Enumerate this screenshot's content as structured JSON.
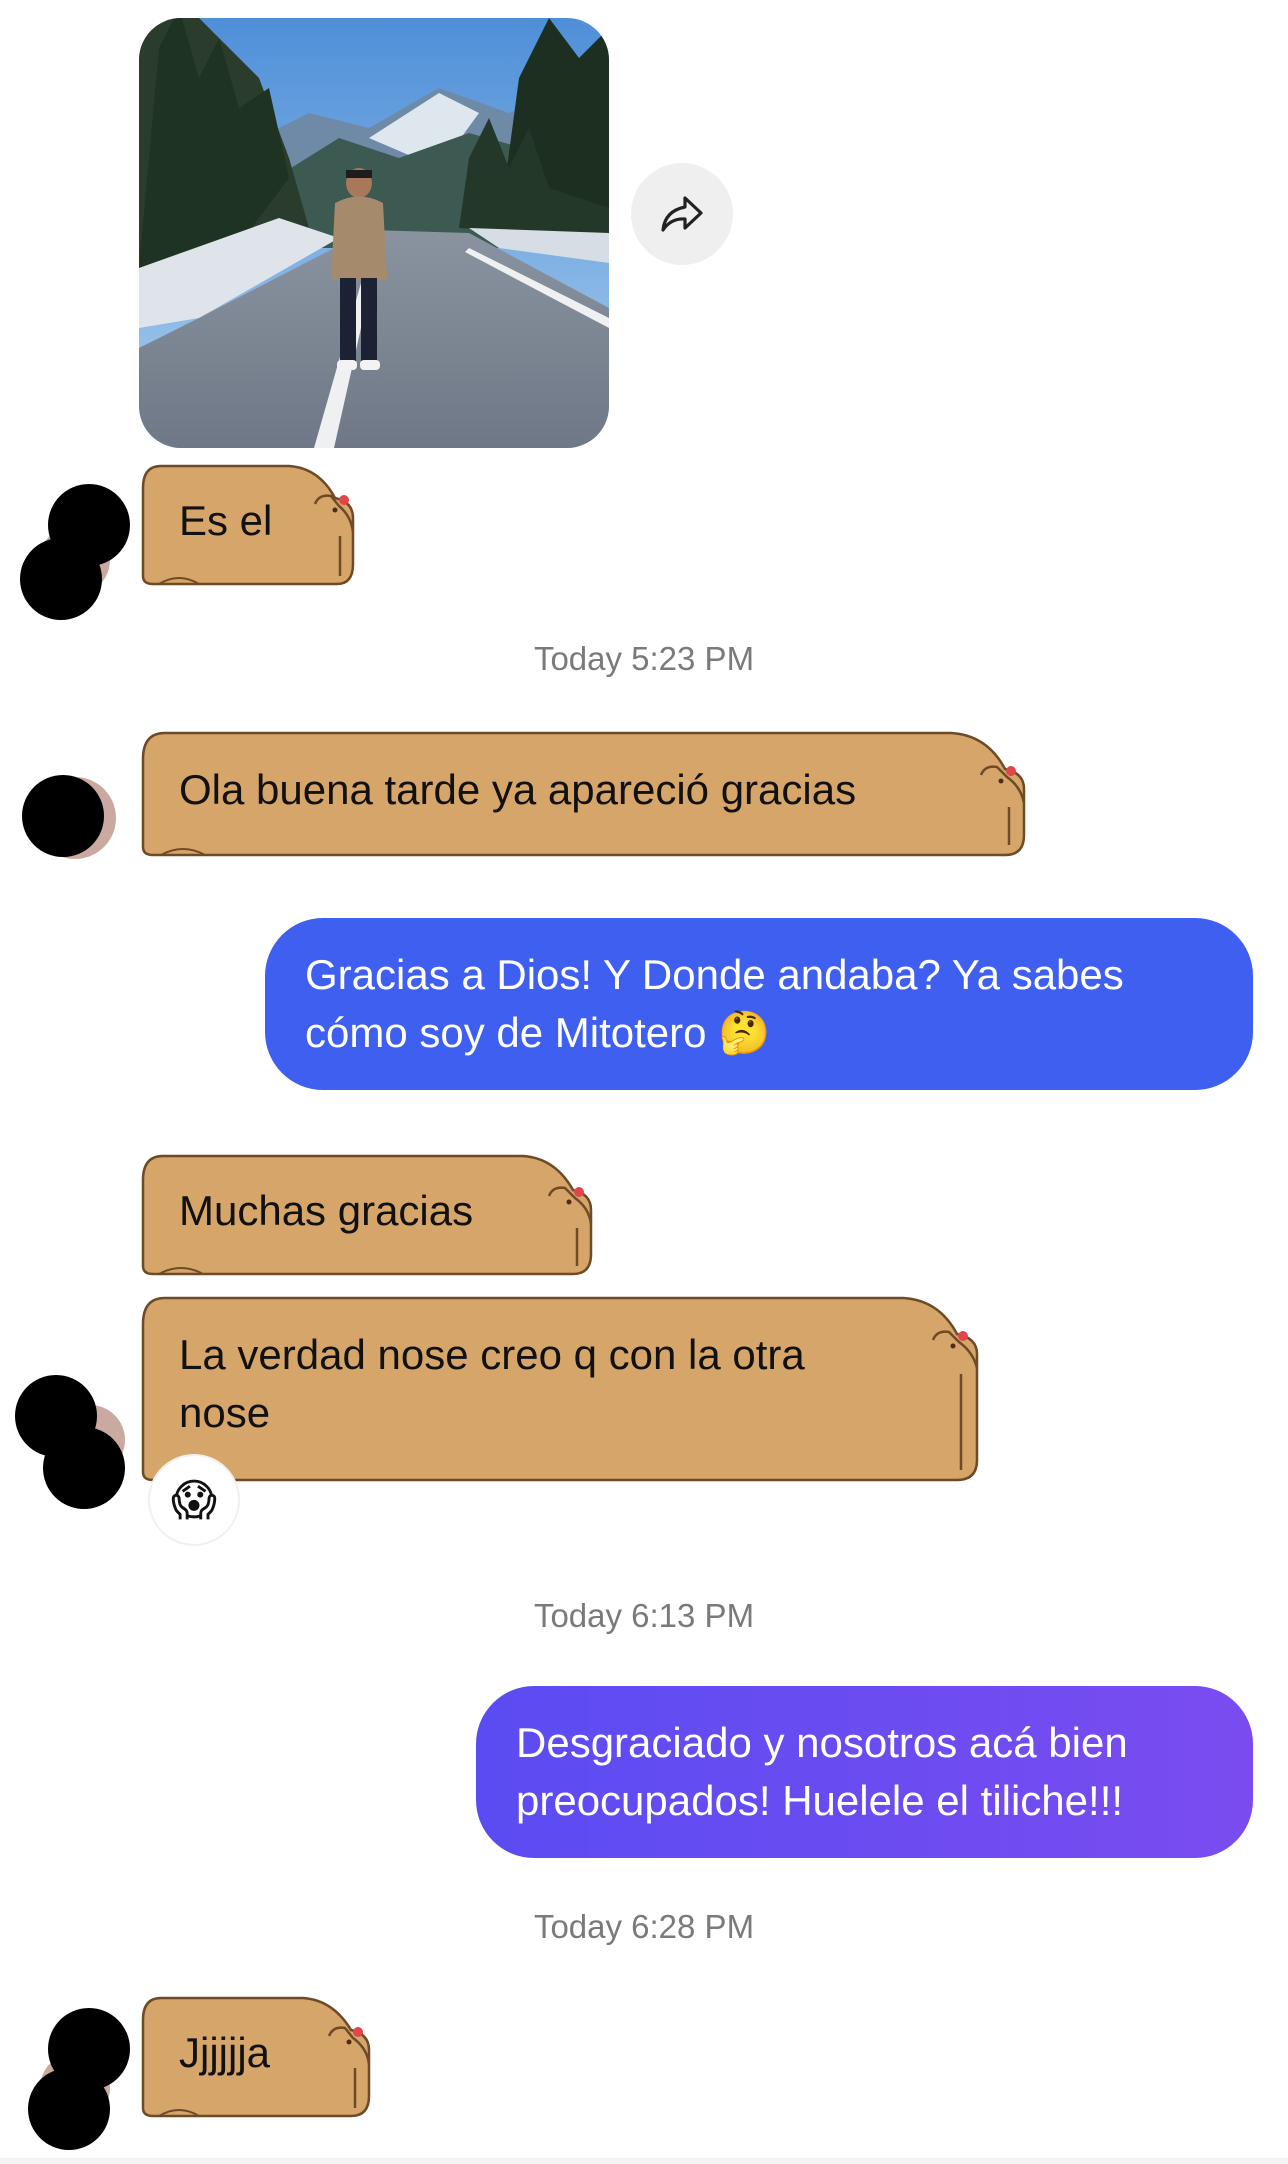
{
  "thread": {
    "shared_photo_alt": "",
    "messages": [
      {
        "id": "m1",
        "direction": "incoming",
        "text": "Es el"
      },
      {
        "id": "ts1",
        "type": "timestamp",
        "text": "Today 5:23 PM"
      },
      {
        "id": "m2",
        "direction": "incoming",
        "text": "Ola buena tarde ya apareció gracias"
      },
      {
        "id": "m3",
        "direction": "outgoing",
        "lines": [
          "Gracias a Dios! Y Donde andaba? Ya sabes",
          "cómo soy de Mitotero 🤔"
        ]
      },
      {
        "id": "m4",
        "direction": "incoming",
        "text": "Muchas gracias"
      },
      {
        "id": "m5",
        "direction": "incoming",
        "lines": [
          "La verdad nose  creo q con la otra",
          "nose"
        ],
        "reaction": "😱"
      },
      {
        "id": "ts2",
        "type": "timestamp",
        "text": "Today 6:13 PM"
      },
      {
        "id": "m6",
        "direction": "outgoing",
        "lines": [
          "Desgraciado y nosotros acá bien",
          "preocupados! Huelele el tiliche!!!"
        ]
      },
      {
        "id": "ts3",
        "type": "timestamp",
        "text": "Today 6:28 PM"
      },
      {
        "id": "m7",
        "direction": "incoming",
        "text": "Jjjjjja"
      }
    ]
  },
  "colors": {
    "incoming_bubble": "#d5a56a",
    "incoming_outline": "#6e4a26",
    "outgoing_blue": "#3f5ff0",
    "outgoing_purple": "#6a4cf0",
    "timestamp": "#7a7a7a",
    "share_button_bg": "#efefef"
  },
  "icons": {
    "share": "share-arrow-icon",
    "bubble_theme": "capybara-bubble"
  }
}
